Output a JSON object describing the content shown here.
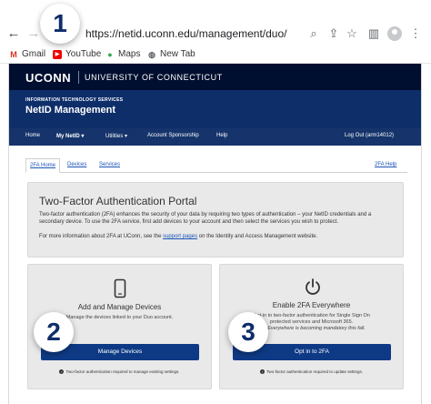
{
  "browser": {
    "url": "https://netid.uconn.edu/management/duo/",
    "bookmarks": [
      {
        "label": "Gmail",
        "icon": "gmail-icon"
      },
      {
        "label": "YouTube",
        "icon": "youtube-icon"
      },
      {
        "label": "Maps",
        "icon": "maps-icon"
      },
      {
        "label": "New Tab",
        "icon": "globe-icon"
      }
    ]
  },
  "site": {
    "logo": "UCONN",
    "university": "UNIVERSITY OF CONNECTICUT",
    "its": "INFORMATION TECHNOLOGY SERVICES",
    "title": "NetID Management"
  },
  "nav": {
    "home": "Home",
    "my_netid": "My NetID",
    "utilities": "Utilities",
    "account_sponsorship": "Account Sponsorship",
    "help": "Help",
    "logout": "Log Out (arm14012)"
  },
  "subnav": {
    "tab_2fa_home": "2FA Home",
    "devices": "Devices",
    "services": "Services",
    "help_2fa": "2FA Help"
  },
  "portal": {
    "title": "Two-Factor Authentication Portal",
    "paragraph1": "Two-factor authentication (2FA) enhances the security of your data by requiring two types of authentication – your NetID credentials and a secondary device. To use the 2FA service, first add devices to your account and then select the services you wish to protect.",
    "paragraph2_pre": "For more information about 2FA at UConn, see the ",
    "paragraph2_link": "support pages",
    "paragraph2_post": " on the Identity and Access Management website."
  },
  "cards": {
    "left": {
      "title": "Add and Manage Devices",
      "desc": "Manage the devices linked to your Duo account.",
      "button": "Manage Devices",
      "note": "Two-factor authentication required to manage existing settings."
    },
    "right": {
      "title": "Enable 2FA Everywhere",
      "desc_line1": "Opt-in to two-factor authentication for Single Sign On",
      "desc_line2": "protected services and Microsoft 365.",
      "desc_line3": "2FA Everywhere is becoming mandatory this fall.",
      "button": "Opt in to 2FA",
      "note": "Two-factor authentication required to update settings."
    }
  },
  "badges": {
    "one": "1",
    "two": "2",
    "three": "3"
  },
  "colors": {
    "uconn_navy": "#000e2f",
    "hero_blue": "#0e2e6a",
    "button_blue": "#0e3a85",
    "link_blue": "#1a55b8"
  }
}
